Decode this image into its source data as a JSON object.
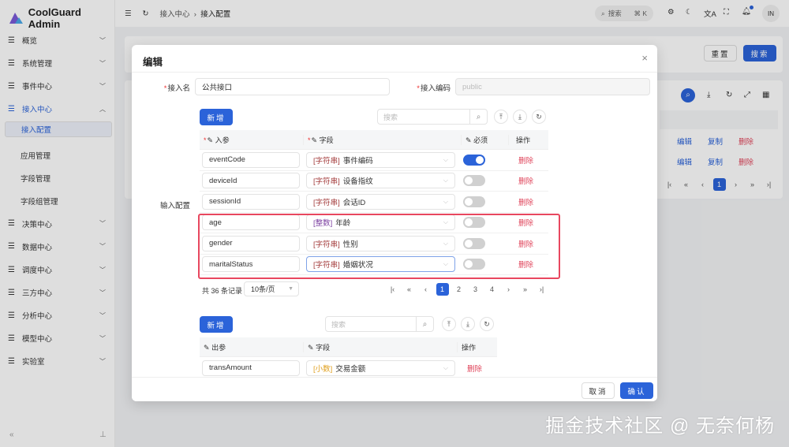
{
  "app": {
    "title": "CoolGuard Admin"
  },
  "sidebar": {
    "items": [
      {
        "label": "概览",
        "expanded": false
      },
      {
        "label": "系统管理",
        "expanded": false
      },
      {
        "label": "事件中心",
        "expanded": false
      },
      {
        "label": "接入中心",
        "expanded": true
      },
      {
        "label": "接入配置",
        "sub": true,
        "selected": true
      },
      {
        "label": "应用管理",
        "sub": true
      },
      {
        "label": "字段管理",
        "sub": true
      },
      {
        "label": "字段组管理",
        "sub": true
      },
      {
        "label": "决策中心",
        "expanded": false
      },
      {
        "label": "数据中心",
        "expanded": false
      },
      {
        "label": "调度中心",
        "expanded": false
      },
      {
        "label": "三方中心",
        "expanded": false
      },
      {
        "label": "分析中心",
        "expanded": false
      },
      {
        "label": "模型中心",
        "expanded": false
      },
      {
        "label": "实验室",
        "expanded": false
      }
    ]
  },
  "header": {
    "breadcrumb": [
      "接入中心",
      "接入配置"
    ],
    "search_label": "搜索",
    "shortcut": "⌘ K",
    "avatar": "IN"
  },
  "background_page": {
    "reset": "重置",
    "search": "搜索",
    "rows": [
      {
        "edit": "编辑",
        "copy": "复制",
        "delete": "删除"
      },
      {
        "edit": "编辑",
        "copy": "复制",
        "delete": "删除"
      }
    ],
    "current_page": "1"
  },
  "modal": {
    "title": "编辑",
    "name_label": "接入名",
    "name_value": "公共接口",
    "code_label": "接入编码",
    "code_value": "public",
    "input_config_label": "输入配置",
    "input": {
      "add": "新增",
      "search_placeholder": "搜索",
      "columns": [
        "入参",
        "字段",
        "必须",
        "操作"
      ],
      "rows": [
        {
          "param": "eventCode",
          "type": "字符串",
          "field": "事件编码",
          "required": true,
          "action": "删除"
        },
        {
          "param": "deviceId",
          "type": "字符串",
          "field": "设备指纹",
          "required": false,
          "action": "删除"
        },
        {
          "param": "sessionId",
          "type": "字符串",
          "field": "会话ID",
          "required": false,
          "action": "删除"
        },
        {
          "param": "age",
          "type": "整数",
          "field": "年龄",
          "required": false,
          "action": "删除"
        },
        {
          "param": "gender",
          "type": "字符串",
          "field": "性别",
          "required": false,
          "action": "删除"
        },
        {
          "param": "maritalStatus",
          "type": "字符串",
          "field": "婚姻状况",
          "required": false,
          "action": "删除"
        }
      ],
      "total": "共 36 条记录",
      "page_size": "10条/页",
      "pages": [
        "1",
        "2",
        "3",
        "4"
      ],
      "current_page": "1"
    },
    "output": {
      "add": "新增",
      "search_placeholder": "搜索",
      "columns": [
        "出参",
        "字段",
        "操作"
      ],
      "rows": [
        {
          "param": "transAmount",
          "type": "小数",
          "field": "交易金额",
          "action": "删除"
        }
      ]
    },
    "cancel": "取消",
    "confirm": "确认"
  },
  "watermark": "掘金技术社区 @ 无奈何杨",
  "colors": {
    "primary": "#2b63d9",
    "danger": "#e0455b",
    "highlight": "#e8475f"
  }
}
